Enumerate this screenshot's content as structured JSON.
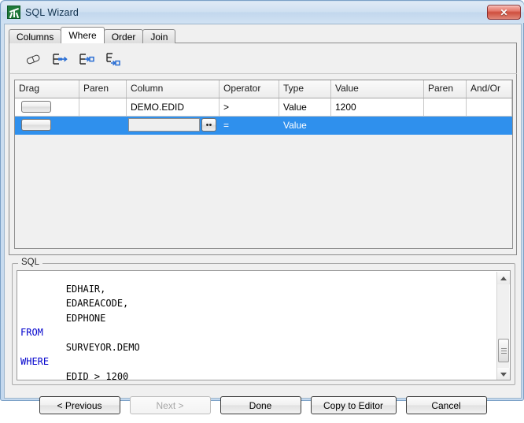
{
  "window": {
    "title": "SQL Wizard",
    "app_icon": "surveyor-theodolite-icon",
    "close_label": "✕"
  },
  "tabs": [
    {
      "label": "Columns",
      "active": false
    },
    {
      "label": "Where",
      "active": true
    },
    {
      "label": "Order",
      "active": false
    },
    {
      "label": "Join",
      "active": false
    }
  ],
  "toolbar": {
    "buttons": [
      {
        "icon": "eraser-icon",
        "title": "Clear"
      },
      {
        "icon": "insert-row-after-icon",
        "title": "Insert row"
      },
      {
        "icon": "insert-row-into-icon",
        "title": "Insert sub-condition"
      },
      {
        "icon": "insert-row-below-icon",
        "title": "Append condition"
      }
    ]
  },
  "grid": {
    "columns": [
      "Drag",
      "Paren",
      "Column",
      "Operator",
      "Type",
      "Value",
      "Paren",
      "And/Or"
    ],
    "rows": [
      {
        "selected": false,
        "drag": "",
        "paren_open": "",
        "column": "DEMO.EDID",
        "operator": ">",
        "type": "Value",
        "value": "1200",
        "paren_close": "",
        "and_or": ""
      },
      {
        "selected": true,
        "drag": "",
        "paren_open": "",
        "column": "",
        "column_placeholder": "",
        "browse_label": "••",
        "operator": "=",
        "type": "Value",
        "value": "",
        "paren_close": "",
        "and_or": ""
      }
    ]
  },
  "sql_panel": {
    "legend": "SQL",
    "lines": [
      {
        "indent": 2,
        "text": "EDHAIR,",
        "keyword": false
      },
      {
        "indent": 2,
        "text": "EDAREACODE,",
        "keyword": false
      },
      {
        "indent": 2,
        "text": "EDPHONE",
        "keyword": false
      },
      {
        "indent": 0,
        "text": "FROM",
        "keyword": true
      },
      {
        "indent": 2,
        "text": "SURVEYOR.DEMO",
        "keyword": false
      },
      {
        "indent": 0,
        "text": "WHERE",
        "keyword": true
      },
      {
        "indent": 2,
        "text": "EDID > 1200",
        "keyword": false
      }
    ],
    "keyword_color": "#0000cc"
  },
  "footer": {
    "buttons": [
      {
        "label": "< Previous",
        "disabled": false,
        "strong": true
      },
      {
        "label": "Next >",
        "disabled": true,
        "strong": false
      },
      {
        "label": "Done",
        "disabled": false,
        "strong": true
      },
      {
        "label": "Copy to Editor",
        "disabled": false,
        "strong": true
      },
      {
        "label": "Cancel",
        "disabled": false,
        "strong": true
      }
    ]
  },
  "colors": {
    "selection_blue": "#2f90ed",
    "title_blue": "#cfe0f1",
    "close_red": "#cf4f3e"
  }
}
